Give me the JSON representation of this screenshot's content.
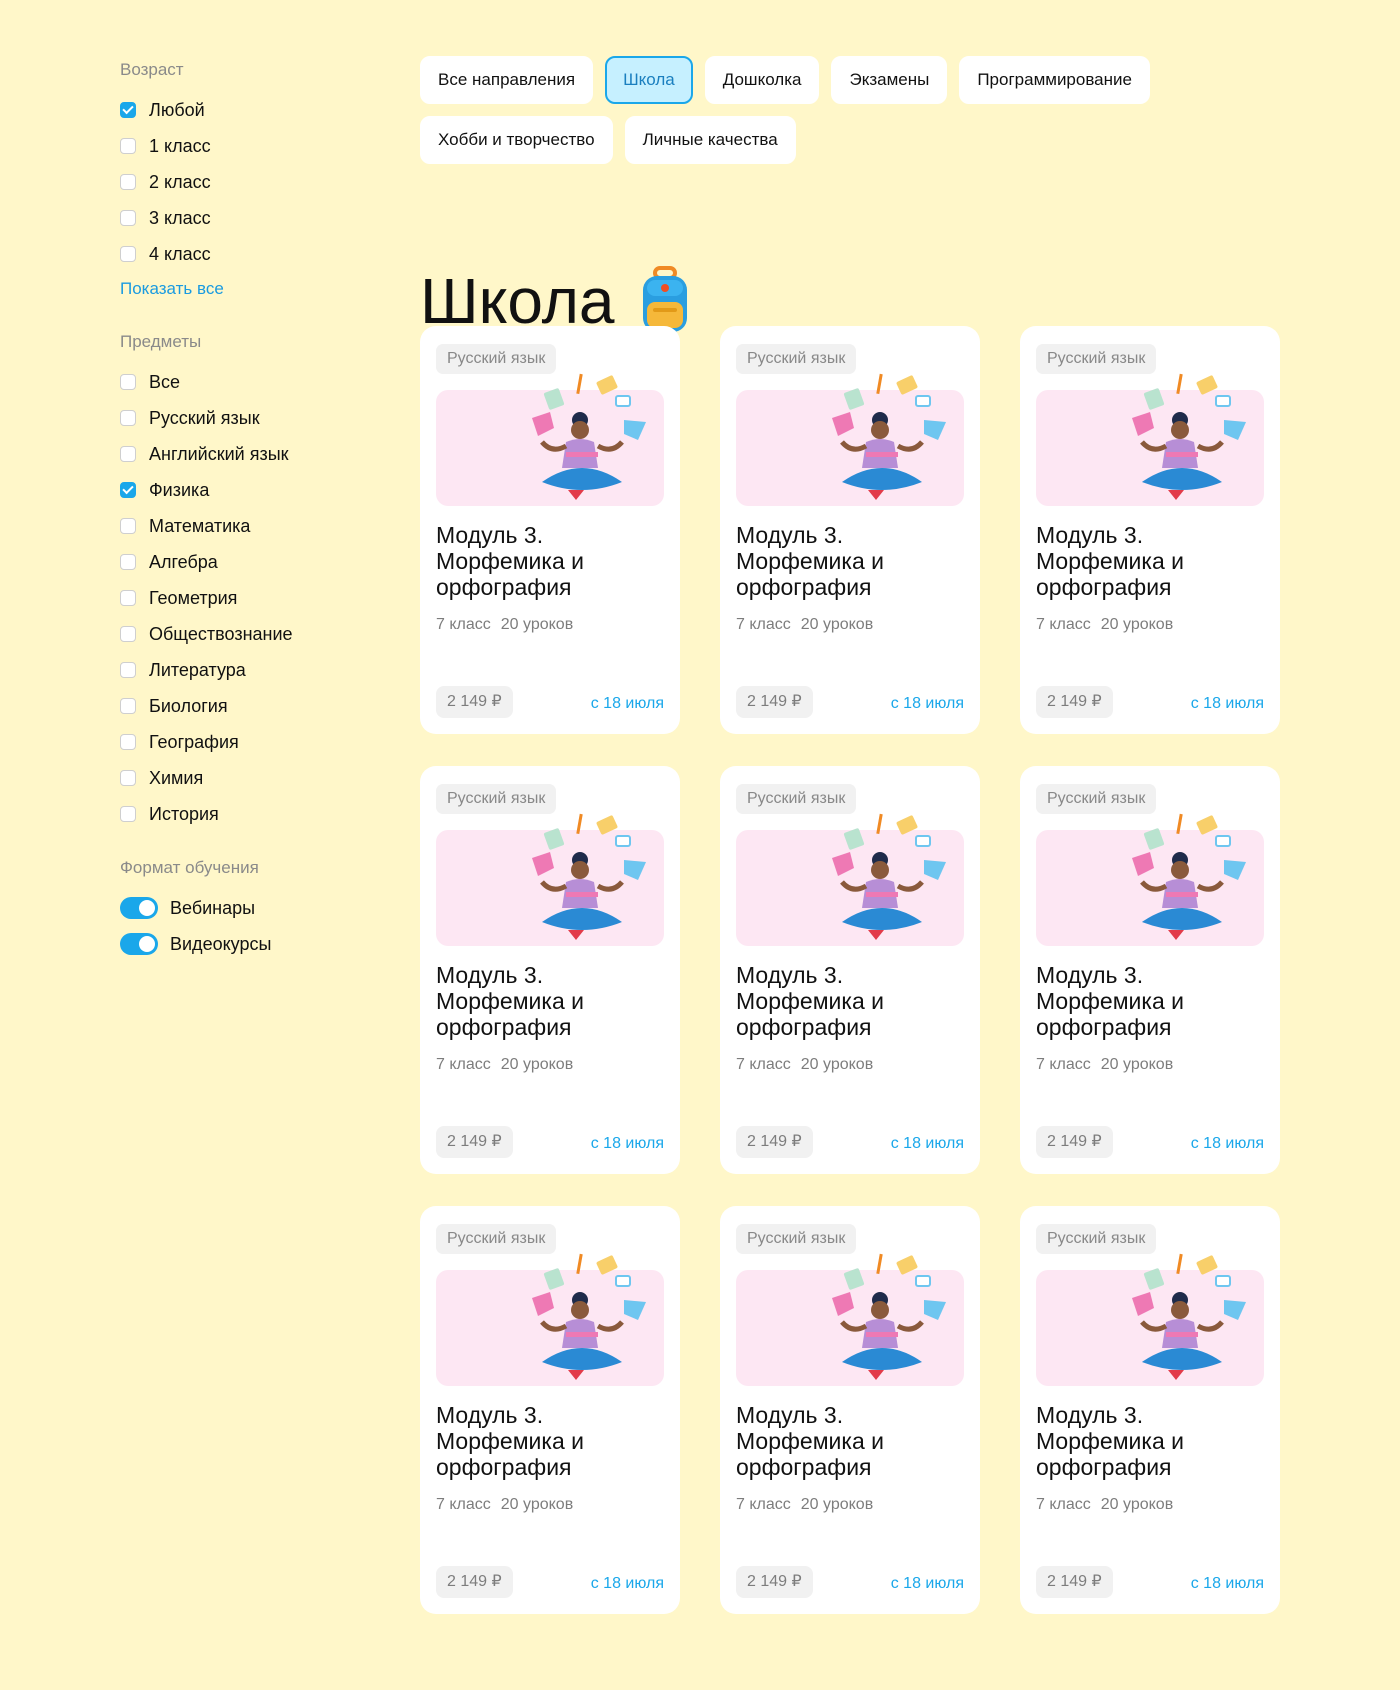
{
  "sidebar": {
    "age": {
      "title": "Возраст",
      "items": [
        {
          "label": "Любой",
          "checked": true
        },
        {
          "label": "1 класс",
          "checked": false
        },
        {
          "label": "2 класс",
          "checked": false
        },
        {
          "label": "3 класс",
          "checked": false
        },
        {
          "label": "4 класс",
          "checked": false
        }
      ],
      "show_all": "Показать все"
    },
    "subjects": {
      "title": "Предметы",
      "items": [
        {
          "label": "Все",
          "checked": false
        },
        {
          "label": "Русский язык",
          "checked": false
        },
        {
          "label": "Английский язык",
          "checked": false
        },
        {
          "label": "Физика",
          "checked": true
        },
        {
          "label": "Математика",
          "checked": false
        },
        {
          "label": "Алгебра",
          "checked": false
        },
        {
          "label": "Геометрия",
          "checked": false
        },
        {
          "label": "Обществознание",
          "checked": false
        },
        {
          "label": "Литература",
          "checked": false
        },
        {
          "label": "Биология",
          "checked": false
        },
        {
          "label": "География",
          "checked": false
        },
        {
          "label": "Химия",
          "checked": false
        },
        {
          "label": "История",
          "checked": false
        }
      ]
    },
    "format": {
      "title": "Формат обучения",
      "items": [
        {
          "label": "Вебинары",
          "on": true
        },
        {
          "label": "Видеокурсы",
          "on": true
        }
      ]
    }
  },
  "tabs": [
    {
      "label": "Все направления",
      "active": false
    },
    {
      "label": "Школа",
      "active": true
    },
    {
      "label": "Дошколка",
      "active": false
    },
    {
      "label": "Экзамены",
      "active": false
    },
    {
      "label": "Программирование",
      "active": false
    },
    {
      "label": "Хобби и творчество",
      "active": false
    },
    {
      "label": "Личные качества",
      "active": false
    }
  ],
  "page_title": "Школа",
  "page_title_icon": "backpack-icon",
  "colors": {
    "background": "#fff7c9",
    "accent": "#1aa7ea",
    "cover": "#fde7f3"
  },
  "cards": [
    {
      "tag": "Русский язык",
      "title": "Модуль 3. Морфемика и орфография",
      "grade": "7 класс",
      "lessons": "20 уроков",
      "price": "2 149 ₽",
      "date": "с 18 июля"
    },
    {
      "tag": "Русский язык",
      "title": "Модуль 3. Морфемика и орфография",
      "grade": "7 класс",
      "lessons": "20 уроков",
      "price": "2 149 ₽",
      "date": "с 18 июля"
    },
    {
      "tag": "Русский язык",
      "title": "Модуль 3. Морфемика и орфография",
      "grade": "7 класс",
      "lessons": "20 уроков",
      "price": "2 149 ₽",
      "date": "с 18 июля"
    },
    {
      "tag": "Русский язык",
      "title": "Модуль 3. Морфемика и орфография",
      "grade": "7 класс",
      "lessons": "20 уроков",
      "price": "2 149 ₽",
      "date": "с 18 июля"
    },
    {
      "tag": "Русский язык",
      "title": "Модуль 3. Морфемика и орфография",
      "grade": "7 класс",
      "lessons": "20 уроков",
      "price": "2 149 ₽",
      "date": "с 18 июля"
    },
    {
      "tag": "Русский язык",
      "title": "Модуль 3. Морфемика и орфография",
      "grade": "7 класс",
      "lessons": "20 уроков",
      "price": "2 149 ₽",
      "date": "с 18 июля"
    },
    {
      "tag": "Русский язык",
      "title": "Модуль 3. Морфемика и орфография",
      "grade": "7 класс",
      "lessons": "20 уроков",
      "price": "2 149 ₽",
      "date": "с 18 июля"
    },
    {
      "tag": "Русский язык",
      "title": "Модуль 3. Морфемика и орфография",
      "grade": "7 класс",
      "lessons": "20 уроков",
      "price": "2 149 ₽",
      "date": "с 18 июля"
    },
    {
      "tag": "Русский язык",
      "title": "Модуль 3. Морфемика и орфография",
      "grade": "7 класс",
      "lessons": "20 уроков",
      "price": "2 149 ₽",
      "date": "с 18 июля"
    }
  ]
}
